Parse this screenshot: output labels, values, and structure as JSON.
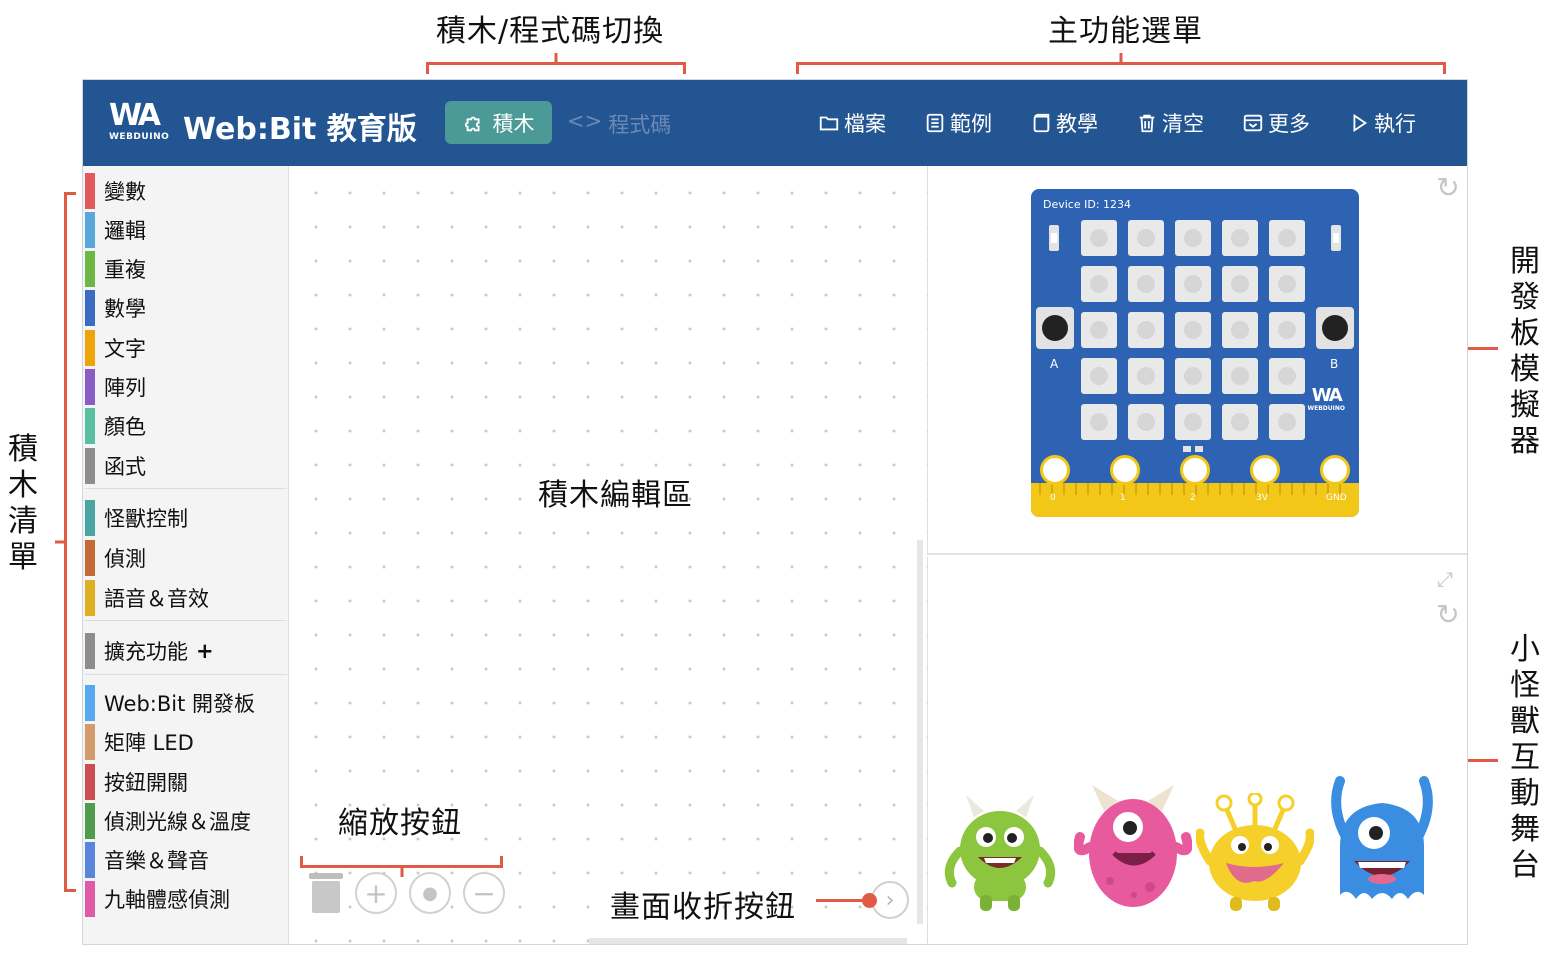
{
  "annotations": {
    "blocks_code_switch": "積木/程式碼切換",
    "main_menu": "主功能選單",
    "block_list": [
      "積",
      "木",
      "清",
      "單"
    ],
    "board_simulator": [
      "開",
      "發",
      "板",
      "模",
      "擬",
      "器"
    ],
    "monster_stage": [
      "小",
      "怪",
      "獸",
      "互",
      "動",
      "舞",
      "台"
    ],
    "block_editor": "積木編輯區",
    "zoom_buttons": "縮放按鈕",
    "collapse_button": "畫面收折按鈕"
  },
  "header": {
    "logo_mark": "WA",
    "logo_sub": "WEBDUINO",
    "title": "Web:Bit 教育版",
    "tab_blocks": "積木",
    "tab_code": "程式碼",
    "tab_code_icon": "<>",
    "menu": [
      {
        "label": "檔案",
        "icon": "folder-icon"
      },
      {
        "label": "範例",
        "icon": "document-icon"
      },
      {
        "label": "教學",
        "icon": "book-icon"
      },
      {
        "label": "清空",
        "icon": "trash-icon"
      },
      {
        "label": "更多",
        "icon": "inbox-icon"
      },
      {
        "label": "執行",
        "icon": "play-icon"
      }
    ]
  },
  "sidebar": {
    "items": [
      {
        "label": "變數",
        "color": "#e05a5e"
      },
      {
        "label": "邏輯",
        "color": "#5aa7dc"
      },
      {
        "label": "重複",
        "color": "#6cb843"
      },
      {
        "label": "數學",
        "color": "#3b6cc4"
      },
      {
        "label": "文字",
        "color": "#f0a40c"
      },
      {
        "label": "陣列",
        "color": "#8a5cc5"
      },
      {
        "label": "顏色",
        "color": "#5abf9e"
      },
      {
        "label": "函式",
        "color": "#8d8d8d"
      },
      {
        "label": "怪獸控制",
        "color": "#4aa6a3"
      },
      {
        "label": "偵測",
        "color": "#c46a37"
      },
      {
        "label": "語音＆音效",
        "color": "#e0b024"
      },
      {
        "label": "擴充功能",
        "color": "#8d8d8d"
      },
      {
        "label": "Web:Bit 開發板",
        "color": "#56a9f0"
      },
      {
        "label": "矩陣 LED",
        "color": "#d39b6a"
      },
      {
        "label": "按鈕開關",
        "color": "#c94d52"
      },
      {
        "label": "偵測光線＆溫度",
        "color": "#4f9c4f"
      },
      {
        "label": "音樂＆聲音",
        "color": "#5b84dc"
      },
      {
        "label": "九軸體感偵測",
        "color": "#e05aa6"
      }
    ],
    "extension_plus": "+"
  },
  "workspace": {
    "zoom_in": "+",
    "zoom_reset": "●",
    "zoom_out": "−",
    "collapse_glyph": "›"
  },
  "simulator": {
    "device_id": "Device ID: 1234",
    "button_a": "A",
    "button_b": "B",
    "pins": [
      "0",
      "1",
      "2",
      "3V",
      "GND"
    ],
    "board_logo": "WA",
    "board_logo_sub": "WEBDUINO",
    "refresh_glyph": "↻"
  },
  "stage": {
    "refresh_glyph": "↻",
    "expand_glyph": "⤢",
    "monsters": [
      {
        "name": "green-monster",
        "color": "#8cc63f"
      },
      {
        "name": "pink-monster",
        "color": "#e85a9e"
      },
      {
        "name": "yellow-monster",
        "color": "#f5d02a"
      },
      {
        "name": "blue-monster",
        "color": "#3a8de0"
      }
    ]
  }
}
